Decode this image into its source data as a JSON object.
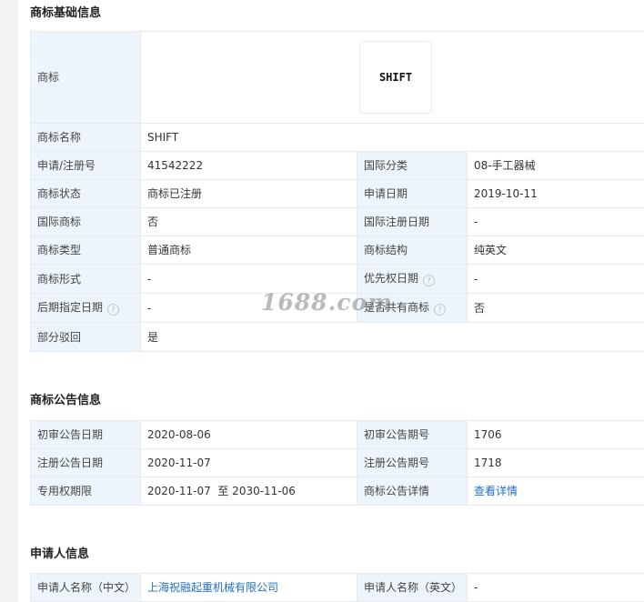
{
  "basic": {
    "title": "商标基础信息",
    "logo_label": "商标",
    "logo_text": "SHIFT",
    "name_label": "商标名称",
    "name_value": "SHIFT",
    "rows": [
      {
        "l1": "申请/注册号",
        "v1": "41542222",
        "l2": "国际分类",
        "v2": "08-手工器械"
      },
      {
        "l1": "商标状态",
        "v1": "商标已注册",
        "l2": "申请日期",
        "v2": "2019-10-11"
      },
      {
        "l1": "国际商标",
        "v1": "否",
        "l2": "国际注册日期",
        "v2": "-"
      },
      {
        "l1": "商标类型",
        "v1": "普通商标",
        "l2": "商标结构",
        "v2": "纯英文"
      },
      {
        "l1": "商标形式",
        "v1": "-",
        "l2": "优先权日期",
        "v2": "-"
      },
      {
        "l1": "后期指定日期",
        "v1": "-",
        "l2": "是否共有商标",
        "v2": "否"
      }
    ],
    "partial_label": "部分驳回",
    "partial_value": "是"
  },
  "notice": {
    "title": "商标公告信息",
    "rows": [
      {
        "l1": "初审公告日期",
        "v1": "2020-08-06",
        "l2": "初审公告期号",
        "v2": "1706"
      },
      {
        "l1": "注册公告日期",
        "v1": "2020-11-07",
        "l2": "注册公告期号",
        "v2": "1718"
      },
      {
        "l1": "专用权期限",
        "v1": "2020-11-07  至 2030-11-06",
        "l2": "商标公告详情",
        "v2": "查看详情"
      }
    ]
  },
  "applicant": {
    "title": "申请人信息",
    "rows": [
      {
        "l1": "申请人名称（中文）",
        "v1": "上海祝融起重机械有限公司",
        "l2": "申请人名称（英文）",
        "v2": "-"
      }
    ]
  },
  "icons": {
    "help": "help-question-icon"
  },
  "watermark": "1688.com",
  "colors": {
    "label_bg": "#eef4fb",
    "border": "#e6e9ee",
    "link": "#1f6fc5"
  }
}
